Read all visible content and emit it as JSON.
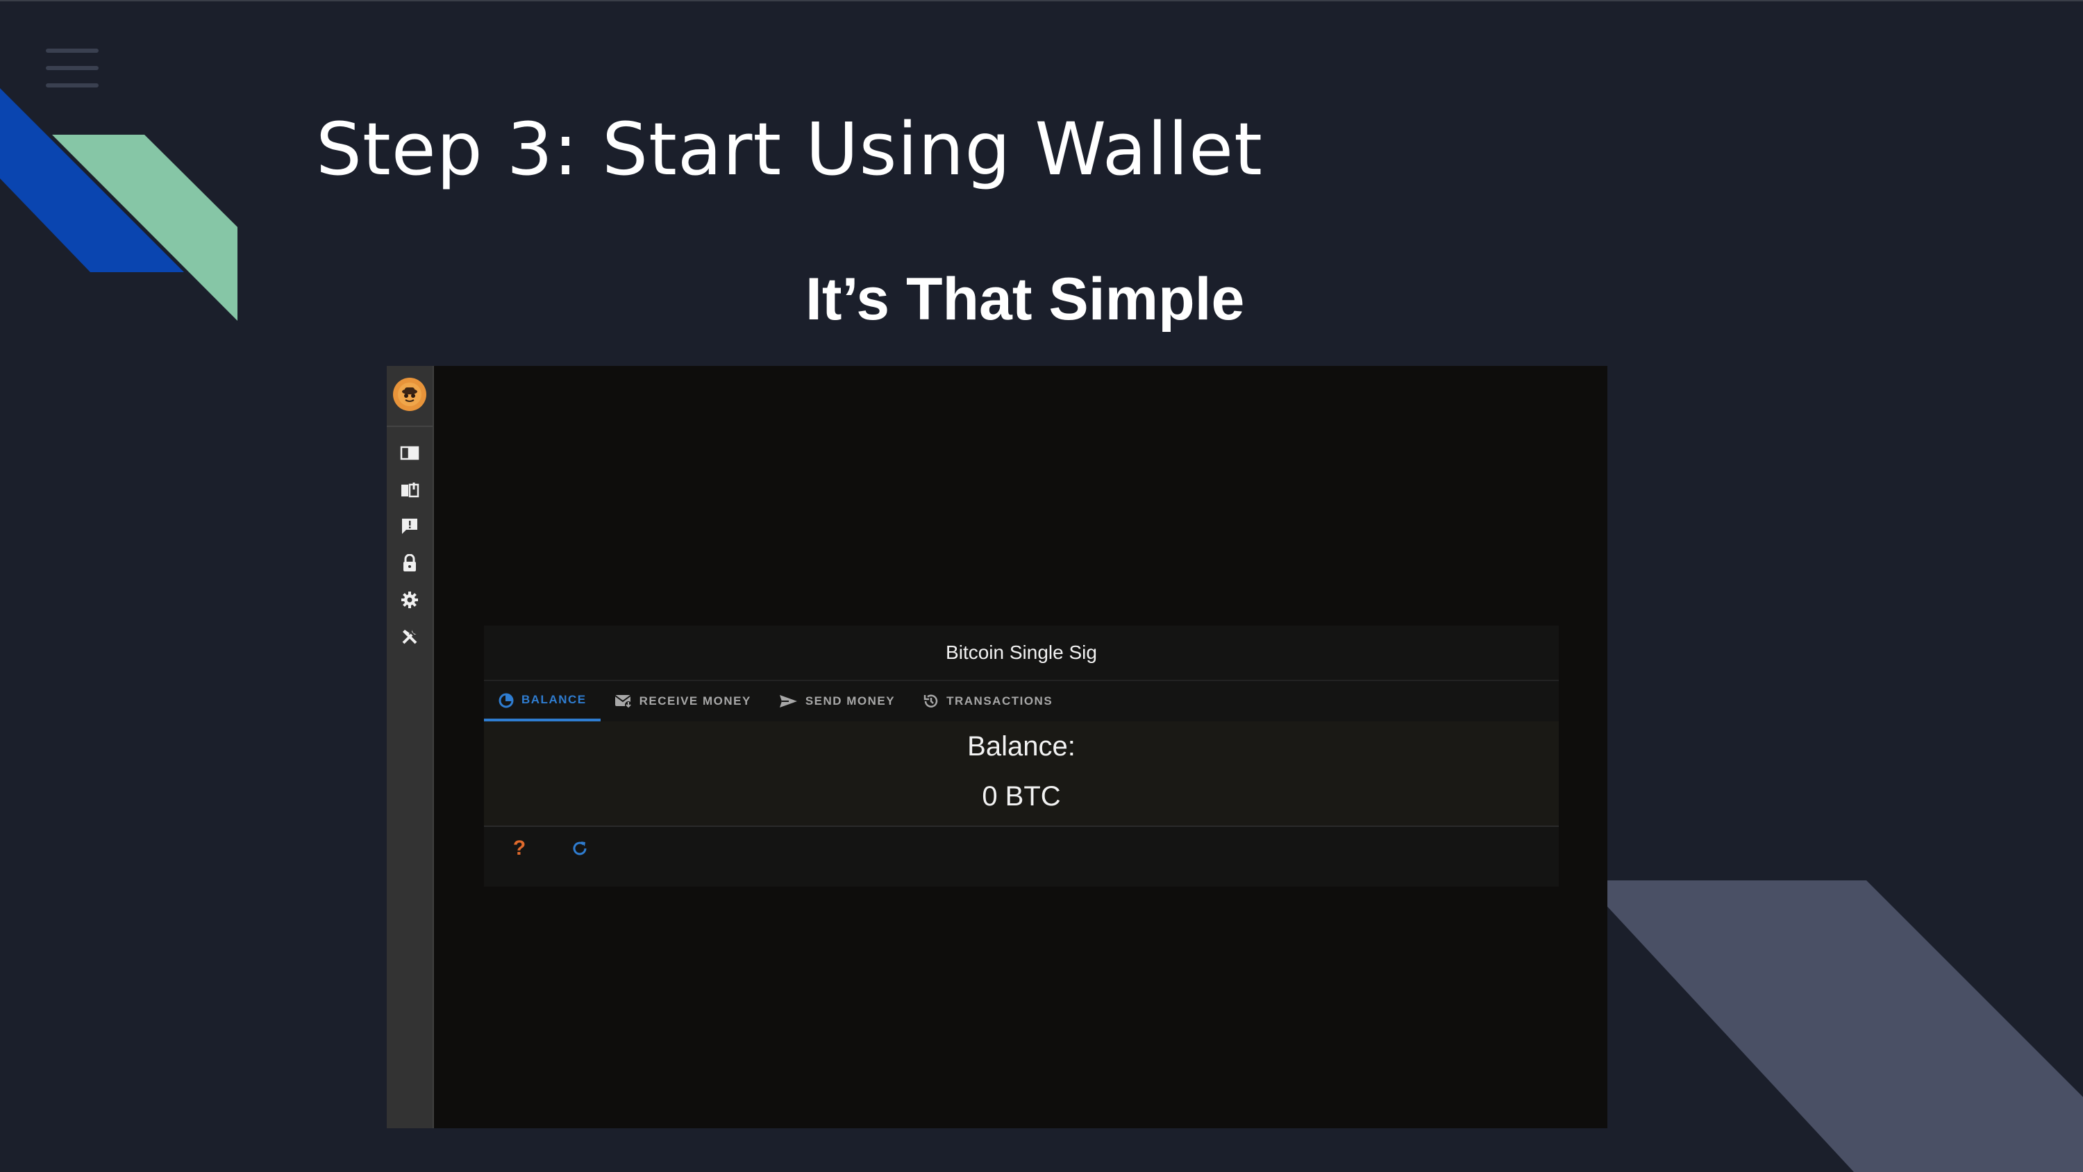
{
  "slide": {
    "title": "Step 3: Start Using Wallet",
    "subtitle": "It’s That Simple"
  },
  "colors": {
    "background": "#1b1f2b",
    "accent_blue": "#0a45b0",
    "accent_green": "#86c6a6",
    "accent_slate": "#4a5065",
    "tab_active": "#2f7dd1"
  },
  "app": {
    "sidebar": {
      "logo_icon": "spy-logo-icon",
      "icons": [
        "book-icon",
        "map-book-icon",
        "feedback-icon",
        "lock-icon",
        "gear-icon",
        "tools-icon"
      ]
    },
    "wallet": {
      "title": "Bitcoin Single Sig",
      "tabs": [
        {
          "label": "BALANCE",
          "icon": "balance-icon",
          "active": true
        },
        {
          "label": "RECEIVE MONEY",
          "icon": "receive-icon",
          "active": false
        },
        {
          "label": "SEND MONEY",
          "icon": "send-icon",
          "active": false
        },
        {
          "label": "TRANSACTIONS",
          "icon": "history-icon",
          "active": false
        }
      ],
      "balance_label": "Balance:",
      "balance_value": "0 BTC",
      "footer_icons": [
        "help-icon",
        "refresh-icon"
      ]
    }
  }
}
